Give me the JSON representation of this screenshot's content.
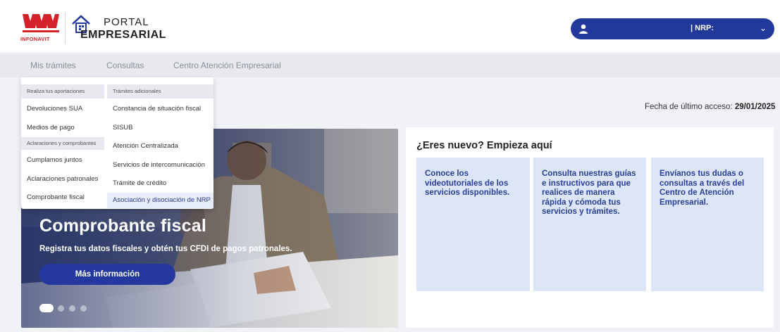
{
  "header": {
    "logo_text": "INFONAVIT",
    "portal_line1": "PORTAL",
    "portal_line2": "EMPRESARIAL",
    "user_nrp_label": "| NRP:"
  },
  "nav": {
    "items": [
      "Mis trámites",
      "Consultas",
      "Centro Atención Empresarial"
    ]
  },
  "dropdown": {
    "col1_header": "Realiza tus aportaciones",
    "col1_items": [
      "Devoluciones SUA",
      "Medios de pago"
    ],
    "col1_header2": "Aclaraciones y comprobantes",
    "col1_items2": [
      "Cumplamos juntos",
      "Aclaraciones patronales",
      "Comprobante fiscal"
    ],
    "col2_header": "Trámites adicionales",
    "col2_items": [
      "Constancia de situación fiscal",
      "SISUB",
      "Atención Centralizada",
      "Servicios de intercomunicación",
      "Trámite de crédito",
      "Asociación y disociación de NRP"
    ],
    "selected_item": "Asociación y disociación de NRP"
  },
  "access": {
    "label": "Fecha de último acceso:",
    "date": "29/01/2025"
  },
  "hero": {
    "title": "Comprobante fiscal",
    "subtitle": "Registra tus datos fiscales y obtén tus CFDI de pagos patronales.",
    "button_label": "Más información",
    "slide_count": 4,
    "active_slide": 1
  },
  "panel": {
    "title": "¿Eres nuevo? Empieza aquí",
    "cards": [
      "Conoce los videotutoriales de los servicios disponibles.",
      "Consulta nuestras guías e instructivos para que realices de manera rápida y cómoda tus servicios y trámites.",
      "Envíanos tus dudas o consultas a través del Centro de Atención Empresarial."
    ]
  },
  "colors": {
    "brand_red": "#d2232a",
    "primary_blue": "#22389a",
    "card_bg": "#dde6f9"
  }
}
